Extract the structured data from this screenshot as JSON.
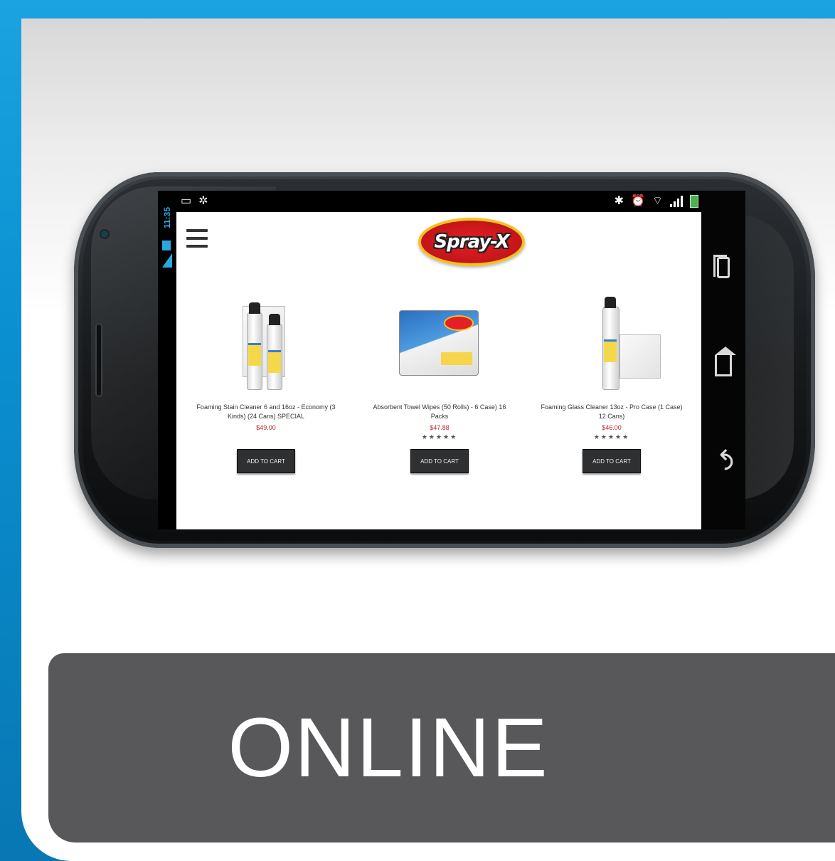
{
  "banner": {
    "label": "ONLINE"
  },
  "phone": {
    "status_bar": {
      "time": "11:35"
    },
    "logo": {
      "text": "Spray-X"
    },
    "products": [
      {
        "name": "Foaming Stain Cleaner 6 and 16oz - Economy (3 Kinds) (24 Cans) SPECIAL",
        "price": "$49.00",
        "stars": "",
        "button": "ADD TO CART"
      },
      {
        "name": "Absorbent Towel Wipes (50 Rolls) - 6 Case) 16 Packs",
        "price": "$47.88",
        "stars": "★★★★★",
        "button": "ADD TO CART"
      },
      {
        "name": "Foaming Glass Cleaner 13oz - Pro Case (1 Case) 12 Cans)",
        "price": "$46.00",
        "stars": "★★★★★",
        "button": "ADD TO CART"
      }
    ]
  },
  "colors": {
    "frame_blue": "#0e8ecf",
    "banner_gray": "#58585a",
    "price_red": "#c0272d",
    "status_accent": "#29a8e0"
  }
}
